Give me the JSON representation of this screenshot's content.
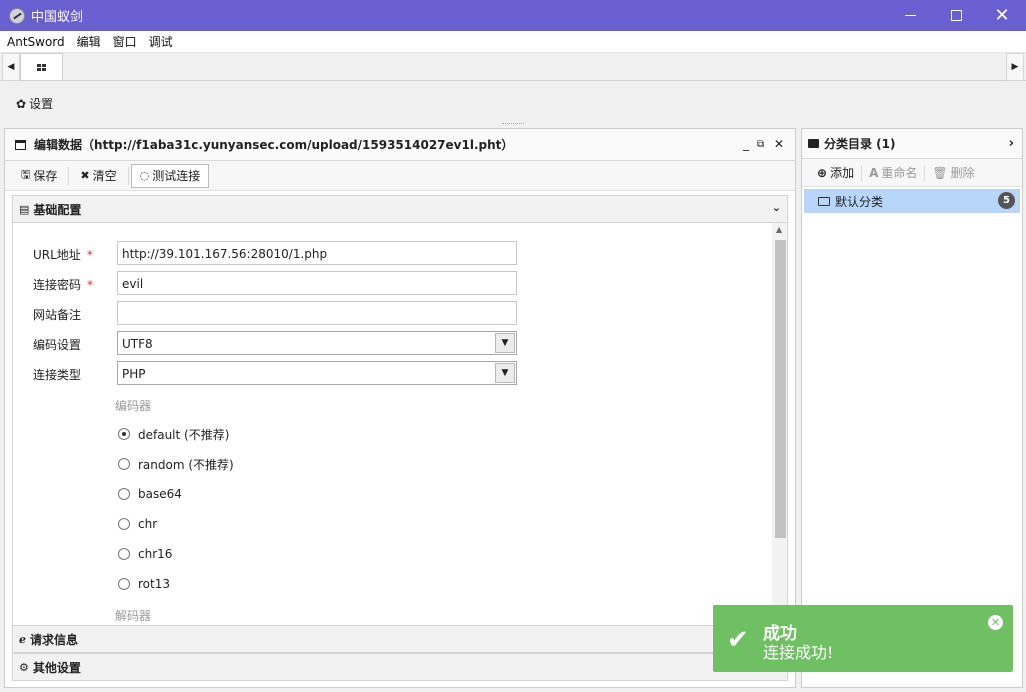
{
  "window": {
    "title": "中国蚁剑",
    "controls": {
      "minimize": "—",
      "maximize": "",
      "close": "✕"
    },
    "title_bar_color": "#6a5fd0"
  },
  "menu": {
    "items": [
      "AntSword",
      "编辑",
      "窗口",
      "调试"
    ]
  },
  "tabs": {
    "left_arrow": "◀",
    "right_arrow": "▶",
    "home_icon": "grid-icon"
  },
  "settings": {
    "label": "设置",
    "icon": "gear-icon"
  },
  "edit_panel": {
    "title": "编辑数据（http://f1aba31c.yunyansec.com/upload/1593514027ev1l.pht）",
    "controls": {
      "minimize": "_",
      "restore": "⧉",
      "close": "✕"
    },
    "toolbar": {
      "save": "保存",
      "clear": "清空",
      "test": "测试连接"
    },
    "sections": {
      "basic": "基础配置",
      "request": "请求信息",
      "other": "其他设置"
    },
    "form": {
      "url_label": "URL地址",
      "url_value": "http://39.101.167.56:28010/1.php",
      "password_label": "连接密码",
      "password_value": "evil",
      "note_label": "网站备注",
      "note_value": "",
      "encoding_label": "编码设置",
      "encoding_value": "UTF8",
      "type_label": "连接类型",
      "type_value": "PHP",
      "required_mark": "*",
      "encoder_group": "编码器",
      "encoders": [
        {
          "label": "default (不推荐)",
          "checked": true
        },
        {
          "label": "random (不推荐)",
          "checked": false
        },
        {
          "label": "base64",
          "checked": false
        },
        {
          "label": "chr",
          "checked": false
        },
        {
          "label": "chr16",
          "checked": false
        },
        {
          "label": "rot13",
          "checked": false
        }
      ],
      "decoder_group": "解码器"
    }
  },
  "category_panel": {
    "title": "分类目录 (1)",
    "toolbar": {
      "add": "添加",
      "rename": "重命名",
      "delete": "删除"
    },
    "items": [
      {
        "label": "默认分类",
        "count": "5"
      }
    ],
    "selected_color": "#b7d6f9"
  },
  "toast": {
    "title": "成功",
    "message": "连接成功!",
    "color": "#6fbf63"
  }
}
